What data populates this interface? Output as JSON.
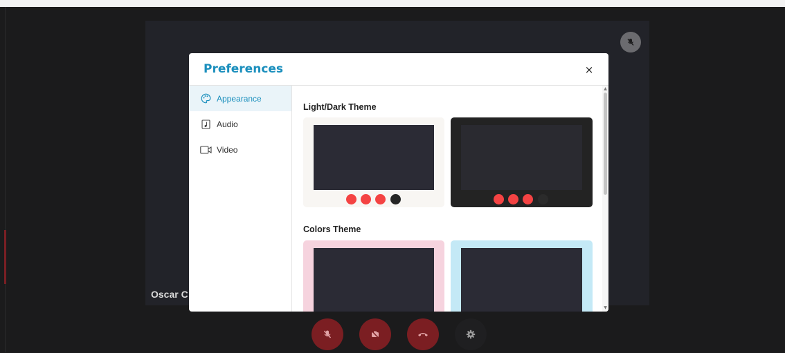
{
  "background": {
    "participant_name": "Oscar C"
  },
  "modal": {
    "title": "Preferences",
    "close_symbol": "×",
    "tabs": [
      {
        "label": "Appearance",
        "icon": "palette-icon",
        "active": true
      },
      {
        "label": "Audio",
        "icon": "music-note-icon",
        "active": false
      },
      {
        "label": "Video",
        "icon": "video-camera-icon",
        "active": false
      }
    ],
    "sections": {
      "light_dark": "Light/Dark Theme",
      "colors": "Colors Theme"
    }
  },
  "colors": {
    "accent": "#1b8fbd",
    "control_red": "#7b1e22",
    "dot_red": "#f44343",
    "light_card": "#f8f6f3",
    "dark_card": "#232323",
    "pink_card": "#f6d3de",
    "blue_card": "#c4e9f6"
  },
  "controls": [
    {
      "name": "mute-mic-button",
      "icon": "mic-off-icon"
    },
    {
      "name": "camera-off-button",
      "icon": "camera-off-icon"
    },
    {
      "name": "hang-up-button",
      "icon": "phone-hangup-icon"
    },
    {
      "name": "settings-button",
      "icon": "gear-icon"
    }
  ]
}
